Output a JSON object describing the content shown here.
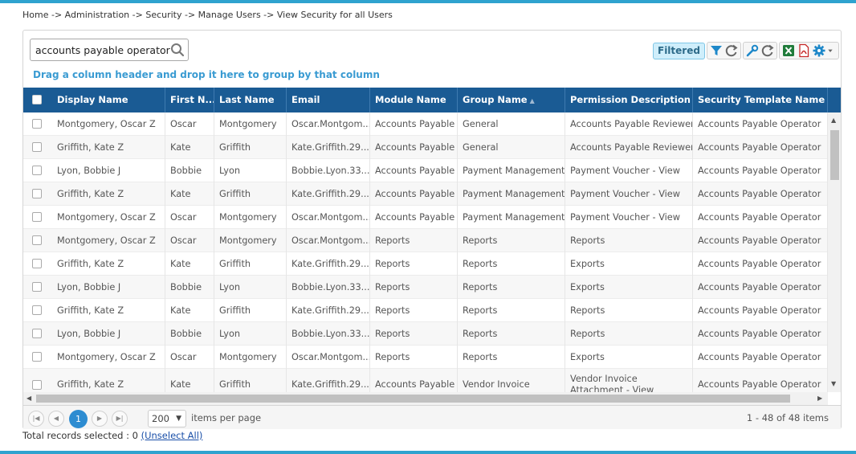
{
  "breadcrumb": "Home -> Administration -> Security -> Manage Users -> View Security for all Users",
  "search": {
    "value": "accounts payable operator",
    "icon": "search-icon"
  },
  "group_hint": "Drag a column header and drop it here to group by that column",
  "toolbar": {
    "filtered_label": "Filtered",
    "icons": [
      "filter-icon",
      "refresh-icon",
      "wrench-icon",
      "refresh-icon",
      "excel-icon",
      "pdf-icon",
      "gear-icon",
      "caret-down-icon"
    ]
  },
  "columns": [
    {
      "label": "Display Name"
    },
    {
      "label": "First N..."
    },
    {
      "label": "Last Name"
    },
    {
      "label": "Email"
    },
    {
      "label": "Module Name"
    },
    {
      "label": "Group Name",
      "sorted": "asc"
    },
    {
      "label": "Permission Description"
    },
    {
      "label": "Security Template Name"
    }
  ],
  "rows": [
    [
      "Montgomery, Oscar Z",
      "Oscar",
      "Montgomery",
      "Oscar.Montgom...",
      "Accounts Payable",
      "General",
      "Accounts Payable Reviewer",
      "Accounts Payable Operator"
    ],
    [
      "Griffith, Kate Z",
      "Kate",
      "Griffith",
      "Kate.Griffith.29...",
      "Accounts Payable",
      "General",
      "Accounts Payable Reviewer",
      "Accounts Payable Operator"
    ],
    [
      "Lyon, Bobbie J",
      "Bobbie",
      "Lyon",
      "Bobbie.Lyon.33...",
      "Accounts Payable",
      "Payment Management",
      "Payment Voucher - View",
      "Accounts Payable Operator"
    ],
    [
      "Griffith, Kate Z",
      "Kate",
      "Griffith",
      "Kate.Griffith.29...",
      "Accounts Payable",
      "Payment Management",
      "Payment Voucher - View",
      "Accounts Payable Operator"
    ],
    [
      "Montgomery, Oscar Z",
      "Oscar",
      "Montgomery",
      "Oscar.Montgom...",
      "Accounts Payable",
      "Payment Management",
      "Payment Voucher - View",
      "Accounts Payable Operator"
    ],
    [
      "Montgomery, Oscar Z",
      "Oscar",
      "Montgomery",
      "Oscar.Montgom...",
      "Reports",
      "Reports",
      "Reports",
      "Accounts Payable Operator"
    ],
    [
      "Griffith, Kate Z",
      "Kate",
      "Griffith",
      "Kate.Griffith.29...",
      "Reports",
      "Reports",
      "Exports",
      "Accounts Payable Operator"
    ],
    [
      "Lyon, Bobbie J",
      "Bobbie",
      "Lyon",
      "Bobbie.Lyon.33...",
      "Reports",
      "Reports",
      "Exports",
      "Accounts Payable Operator"
    ],
    [
      "Griffith, Kate Z",
      "Kate",
      "Griffith",
      "Kate.Griffith.29...",
      "Reports",
      "Reports",
      "Reports",
      "Accounts Payable Operator"
    ],
    [
      "Lyon, Bobbie J",
      "Bobbie",
      "Lyon",
      "Bobbie.Lyon.33...",
      "Reports",
      "Reports",
      "Reports",
      "Accounts Payable Operator"
    ],
    [
      "Montgomery, Oscar Z",
      "Oscar",
      "Montgomery",
      "Oscar.Montgom...",
      "Reports",
      "Reports",
      "Exports",
      "Accounts Payable Operator"
    ],
    [
      "Griffith, Kate Z",
      "Kate",
      "Griffith",
      "Kate.Griffith.29...",
      "Accounts Payable",
      "Vendor Invoice",
      "Vendor Invoice Attachment - View Attachment",
      "Accounts Payable Operator"
    ]
  ],
  "pager": {
    "current_page": "1",
    "page_size": "200",
    "items_label": "items per page",
    "info": "1 - 48 of 48 items"
  },
  "footer": {
    "selected_text": "Total records selected : 0",
    "unselect_link": "(Unselect All)"
  },
  "colors": {
    "accent": "#2fa3cf",
    "header_bg": "#1a5b94",
    "link": "#3a9bd2"
  }
}
